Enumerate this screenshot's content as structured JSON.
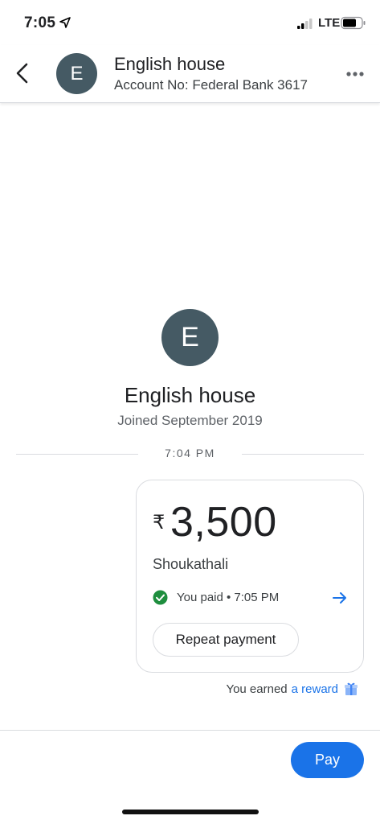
{
  "status_bar": {
    "time": "7:05",
    "network": "LTE",
    "icons": [
      "location-arrow-icon",
      "signal-icon",
      "battery-icon"
    ]
  },
  "header": {
    "avatar_letter": "E",
    "title": "English house",
    "subtitle": "Account No: Federal Bank 3617",
    "icons": [
      "back-arrow-icon",
      "more-dots-icon"
    ]
  },
  "profile": {
    "avatar_letter": "E",
    "name": "English house",
    "joined": "Joined September 2019"
  },
  "divider_time": "7:04 PM",
  "payment": {
    "currency_symbol": "₹",
    "amount": "3,500",
    "payee": "Shoukathali",
    "status": "You paid • 7:05 PM",
    "repeat_label": "Repeat payment",
    "icons": [
      "check-circle-icon",
      "arrow-right-icon"
    ]
  },
  "reward": {
    "prefix": "You earned",
    "link": "a reward",
    "icon": "gift-icon"
  },
  "pay_label": "Pay",
  "colors": {
    "accent": "#1a73e8",
    "avatar": "#455a64",
    "success": "#1e8e3e",
    "divider": "#dadce0"
  }
}
